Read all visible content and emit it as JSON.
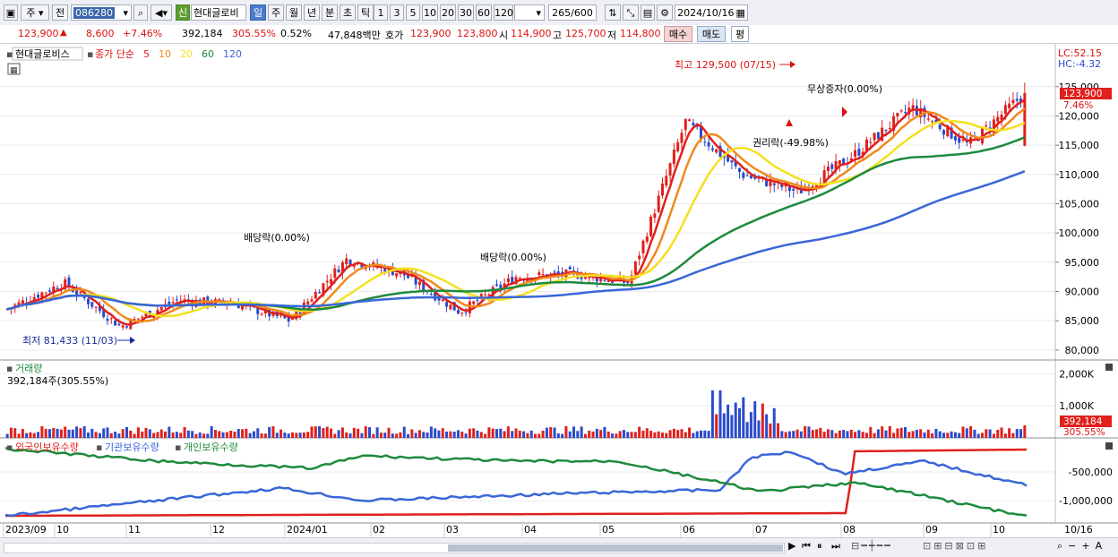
{
  "toolbar": {
    "market": "주",
    "prev_label": "전",
    "code": "086280",
    "new_badge": "신",
    "stock_name": "현대글로비",
    "periods": [
      "일",
      "주",
      "월",
      "년",
      "분",
      "초",
      "틱"
    ],
    "intervals": [
      "1",
      "3",
      "5",
      "10",
      "20",
      "30",
      "60",
      "120"
    ],
    "count": "265",
    "count_total": "/600",
    "date": "2024/10/16"
  },
  "info": {
    "price": "123,900",
    "change": "8,600",
    "change_pct": "+7.46%",
    "volume": "392,184",
    "vol_ratio": "305.55%",
    "turnover_pct": "0.52%",
    "amount": "47,848백만",
    "quote_label": "호가",
    "ask": "123,900",
    "bid": "123,800",
    "open_label": "시",
    "open": "114,900",
    "high_label": "고",
    "high": "125,700",
    "low_label": "저",
    "low": "114,800",
    "buy": "매수",
    "sell": "매도",
    "eval": "평"
  },
  "price_panel": {
    "title": "현대글로비스",
    "legend_prefix": "종가 단순",
    "ma": [
      {
        "label": "5",
        "color": "#e0201c"
      },
      {
        "label": "10",
        "color": "#f08a1c"
      },
      {
        "label": "20",
        "color": "#f5e021"
      },
      {
        "label": "60",
        "color": "#1e8a3c"
      },
      {
        "label": "120",
        "color": "#3a66d8"
      }
    ],
    "lc": "LC:52.15",
    "hc": "HC:-4.32",
    "current_tag": "123,900",
    "current_pct": "7.46%",
    "y_ticks": [
      "125,000",
      "120,000",
      "115,000",
      "110,000",
      "105,000",
      "100,000",
      "95,000",
      "90,000",
      "85,000",
      "80,000"
    ],
    "high_label": "최고 129,500 (07/15)",
    "low_label": "최저 81,433 (11/03)",
    "events": [
      "배당락(0.00%)",
      "배당락(0.00%)",
      "무상증자(0.00%)",
      "권리락(-49.98%)"
    ]
  },
  "volume_panel": {
    "title": "거래량",
    "value": "392,184주(305.55%)",
    "y_ticks": [
      "2,000K",
      "1,000K"
    ],
    "current_tag": "392,184",
    "current_pct": "305.55%"
  },
  "holding_panel": {
    "series": [
      {
        "label": "외국인보유수량",
        "color": "#e0201c"
      },
      {
        "label": "기관보유수량",
        "color": "#3a66d8"
      },
      {
        "label": "개인보유수량",
        "color": "#1e8a3c"
      }
    ],
    "y_ticks": [
      "-500,000",
      "-1,000,000"
    ]
  },
  "x_axis": [
    "2023/09",
    "10",
    "11",
    "12",
    "2024/01",
    "02",
    "03",
    "04",
    "05",
    "06",
    "07",
    "08",
    "09",
    "10",
    "10/16"
  ],
  "chart_data": {
    "type": "candlestick",
    "title": "현대글로비스",
    "ylim": [
      78000,
      131000
    ],
    "x": [
      "2023/09",
      "10",
      "11",
      "12",
      "2024/01",
      "02",
      "03",
      "04",
      "05",
      "06",
      "07",
      "08",
      "09",
      "10",
      "10/16"
    ],
    "close_approx": [
      87000,
      91500,
      84000,
      88500,
      88000,
      85000,
      95500,
      93000,
      86500,
      92500,
      93000,
      91500,
      119000,
      110000,
      107000,
      113500,
      121500,
      115000,
      123900
    ],
    "high": 129500,
    "low": 81433,
    "moving_averages": [
      "5",
      "10",
      "20",
      "60",
      "120"
    ]
  }
}
